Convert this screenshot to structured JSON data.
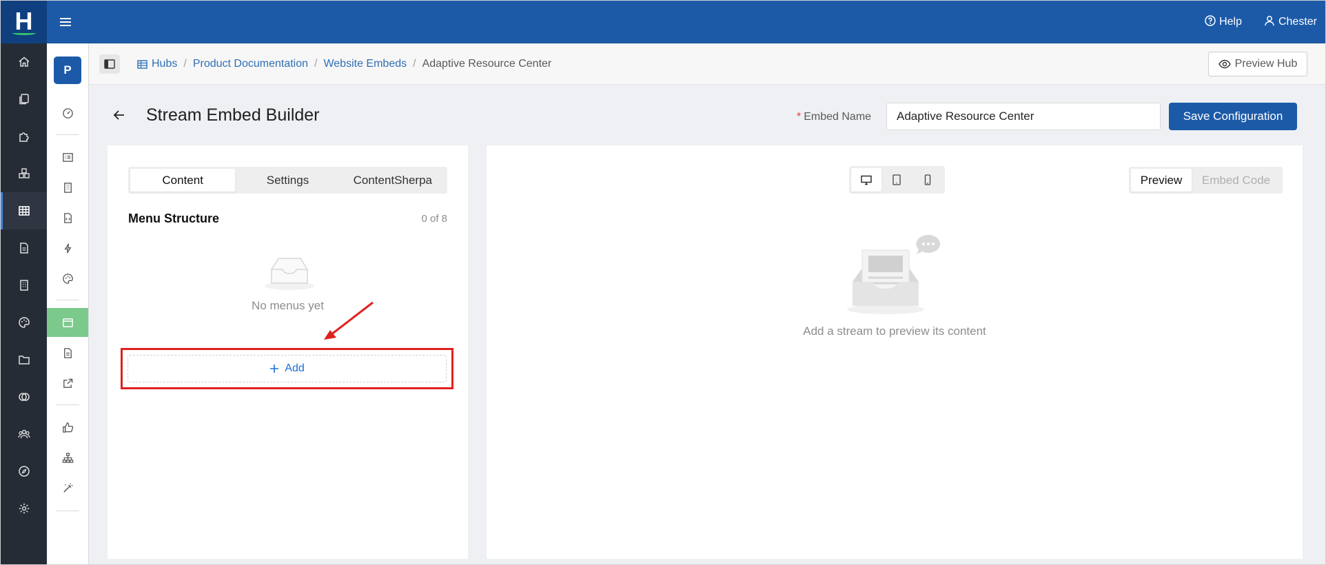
{
  "app": {
    "logo_letter": "H"
  },
  "topbar": {
    "help_label": "Help",
    "user_label": "Chester"
  },
  "rail": {
    "items": [
      {
        "icon": "home-icon"
      },
      {
        "icon": "copy-icon"
      },
      {
        "icon": "puzzle-icon"
      },
      {
        "icon": "cubes-icon"
      },
      {
        "icon": "table-icon",
        "active": true
      },
      {
        "icon": "document-icon"
      },
      {
        "icon": "building-icon"
      },
      {
        "icon": "palette-icon"
      },
      {
        "icon": "folder-icon"
      },
      {
        "icon": "overlap-circles-icon"
      },
      {
        "icon": "users-icon"
      },
      {
        "icon": "compass-icon"
      },
      {
        "icon": "settings-icon"
      }
    ]
  },
  "subbar": {
    "avatar_letter": "P"
  },
  "breadcrumb": {
    "items": [
      "Hubs",
      "Product Documentation",
      "Website Embeds"
    ],
    "current": "Adaptive Resource Center"
  },
  "preview_hub_label": "Preview Hub",
  "page": {
    "title": "Stream Embed Builder",
    "embed_name_label": "Embed Name",
    "embed_name_value": "Adaptive Resource Center",
    "save_label": "Save Configuration"
  },
  "left_panel": {
    "tabs": [
      {
        "label": "Content",
        "active": true
      },
      {
        "label": "Settings",
        "active": false
      },
      {
        "label": "ContentSherpa",
        "active": false
      }
    ],
    "menu_title": "Menu Structure",
    "menu_count": "0 of 8",
    "empty_text": "No menus yet",
    "add_label": "Add"
  },
  "right_panel": {
    "devices": [
      "desktop-icon",
      "tablet-icon",
      "mobile-icon"
    ],
    "active_device": "desktop",
    "view_tabs": [
      {
        "label": "Preview",
        "active": true
      },
      {
        "label": "Embed Code",
        "active": false
      }
    ],
    "empty_text": "Add a stream to preview its content"
  },
  "colors": {
    "brand": "#1c5aa8",
    "rail": "#262c36",
    "active_subitem": "#7cc98c",
    "link": "#2f6fb5",
    "highlight": "#e02020",
    "required": "#e03b3b"
  }
}
